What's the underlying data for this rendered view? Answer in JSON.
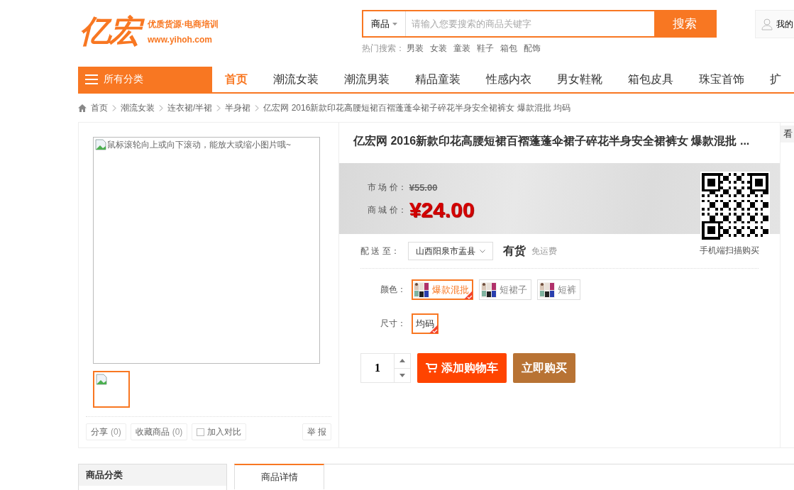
{
  "logo": {
    "mark": "亿宏",
    "tagline": "优质货源·电商培训",
    "url": "www.yihoh.com"
  },
  "search": {
    "scope": "商品",
    "placeholder": "请输入您要搜索的商品关键字",
    "button": "搜索",
    "hot_label": "热门搜索：",
    "hot": [
      "男装",
      "女装",
      "童装",
      "鞋子",
      "箱包",
      "配饰"
    ]
  },
  "user": {
    "label": "我的"
  },
  "nav": {
    "category": "所有分类",
    "items": [
      {
        "label": "首页",
        "selected": true
      },
      {
        "label": "潮流女装",
        "selected": false
      },
      {
        "label": "潮流男装",
        "selected": false
      },
      {
        "label": "精品童装",
        "selected": false
      },
      {
        "label": "性感内衣",
        "selected": false
      },
      {
        "label": "男女鞋靴",
        "selected": false
      },
      {
        "label": "箱包皮具",
        "selected": false
      },
      {
        "label": "珠宝首饰",
        "selected": false
      },
      {
        "label": "扩",
        "selected": false
      }
    ]
  },
  "breadcrumb": [
    "首页",
    "潮流女装",
    "连衣裙/半裙",
    "半身裙",
    "亿宏网 2016新款印花高腰短裙百褶蓬蓬伞裙子碎花半身安全裙裤女 爆款混批 均码"
  ],
  "gallery": {
    "alt": "鼠标滚轮向上或向下滚动，能放大或缩小图片哦~",
    "thumbnails": [
      {
        "selected": true
      }
    ],
    "actions": [
      {
        "kind": "button",
        "label": "分享",
        "count": "(0)"
      },
      {
        "kind": "button",
        "label": "收藏商品",
        "count": "(0)"
      },
      {
        "kind": "checkbox",
        "label": "加入对比",
        "checked": false
      }
    ],
    "report": "举 报"
  },
  "product": {
    "title": "亿宏网 2016新款印花高腰短裙百褶蓬蓬伞裙子碎花半身安全裙裤女 爆款混批 ...",
    "market_label": "市 场 价：",
    "market_price": "¥55.00",
    "price_label": "商 城 价：",
    "price": "¥24.00",
    "qr_caption": "手机端扫描购买",
    "ship_label": "配 送 至：",
    "ship_region": "山西阳泉市盂县",
    "stock": "有货",
    "freight": "免运费",
    "options": [
      {
        "label": "颜色：",
        "values": [
          {
            "kind": "picture",
            "text": "爆款混批",
            "selected": true
          },
          {
            "kind": "picture",
            "text": "短裙子",
            "selected": false
          },
          {
            "kind": "picture",
            "text": "短裤",
            "selected": false
          }
        ]
      },
      {
        "label": "尺寸：",
        "values": [
          {
            "kind": "text",
            "text": "均码",
            "selected": true
          }
        ]
      }
    ],
    "quantity": "1",
    "cart_button": "添加购物车",
    "buy_button": "立即购买"
  },
  "side_tab": "看",
  "category_panel": {
    "title": "商品分类"
  },
  "detail_tabs": [
    {
      "label": "商品详情",
      "selected": true
    }
  ]
}
